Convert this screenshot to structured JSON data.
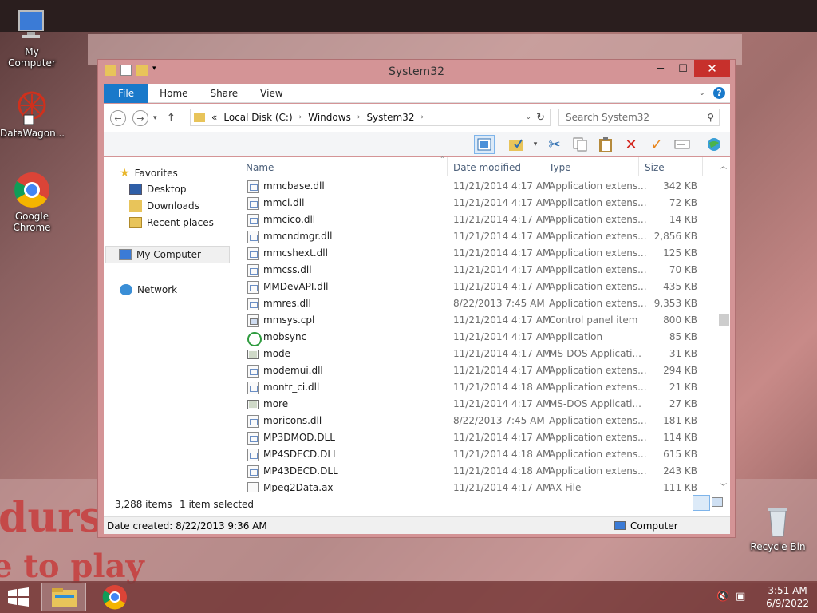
{
  "desktop": {
    "icons": [
      {
        "label": "My Computer"
      },
      {
        "label": "DataWagon..."
      },
      {
        "label": "Google Chrome"
      },
      {
        "label": "Recycle Bin"
      }
    ],
    "wallpaper_text": [
      "durst",
      "e to play"
    ]
  },
  "window": {
    "title": "System32",
    "buttons": {
      "minimize": "─",
      "maximize": "☐",
      "close": "✕"
    },
    "ribbon_tabs": [
      "File",
      "Home",
      "Share",
      "View"
    ],
    "address": {
      "prefix": "«",
      "crumbs": [
        "Local Disk (C:)",
        "Windows",
        "System32"
      ]
    },
    "search_placeholder": "Search System32",
    "accent": "#1979ca"
  },
  "navpane": {
    "items": [
      {
        "label": "Favorites"
      },
      {
        "label": "Desktop"
      },
      {
        "label": "Downloads"
      },
      {
        "label": "Recent places"
      },
      {
        "label": "My Computer"
      },
      {
        "label": "Network"
      }
    ]
  },
  "columns": [
    "Name",
    "Date modified",
    "Type",
    "Size"
  ],
  "files": [
    {
      "name": "mmcbase.dll",
      "date": "11/21/2014 4:17 AM",
      "type": "Application extens...",
      "size": "342 KB",
      "icon": "dll"
    },
    {
      "name": "mmci.dll",
      "date": "11/21/2014 4:17 AM",
      "type": "Application extens...",
      "size": "72 KB",
      "icon": "dll"
    },
    {
      "name": "mmcico.dll",
      "date": "11/21/2014 4:17 AM",
      "type": "Application extens...",
      "size": "14 KB",
      "icon": "dll"
    },
    {
      "name": "mmcndmgr.dll",
      "date": "11/21/2014 4:17 AM",
      "type": "Application extens...",
      "size": "2,856 KB",
      "icon": "dll"
    },
    {
      "name": "mmcshext.dll",
      "date": "11/21/2014 4:17 AM",
      "type": "Application extens...",
      "size": "125 KB",
      "icon": "dll"
    },
    {
      "name": "mmcss.dll",
      "date": "11/21/2014 4:17 AM",
      "type": "Application extens...",
      "size": "70 KB",
      "icon": "dll"
    },
    {
      "name": "MMDevAPI.dll",
      "date": "11/21/2014 4:17 AM",
      "type": "Application extens...",
      "size": "435 KB",
      "icon": "dll"
    },
    {
      "name": "mmres.dll",
      "date": "8/22/2013 7:45 AM",
      "type": "Application extens...",
      "size": "9,353 KB",
      "icon": "dll"
    },
    {
      "name": "mmsys.cpl",
      "date": "11/21/2014 4:17 AM",
      "type": "Control panel item",
      "size": "800 KB",
      "icon": "cpl"
    },
    {
      "name": "mobsync",
      "date": "11/21/2014 4:17 AM",
      "type": "Application",
      "size": "85 KB",
      "icon": "app"
    },
    {
      "name": "mode",
      "date": "11/21/2014 4:17 AM",
      "type": "MS-DOS Applicati...",
      "size": "31 KB",
      "icon": "msdos"
    },
    {
      "name": "modemui.dll",
      "date": "11/21/2014 4:17 AM",
      "type": "Application extens...",
      "size": "294 KB",
      "icon": "dll"
    },
    {
      "name": "montr_ci.dll",
      "date": "11/21/2014 4:18 AM",
      "type": "Application extens...",
      "size": "21 KB",
      "icon": "dll"
    },
    {
      "name": "more",
      "date": "11/21/2014 4:17 AM",
      "type": "MS-DOS Applicati...",
      "size": "27 KB",
      "icon": "msdos"
    },
    {
      "name": "moricons.dll",
      "date": "8/22/2013 7:45 AM",
      "type": "Application extens...",
      "size": "181 KB",
      "icon": "dll"
    },
    {
      "name": "MP3DMOD.DLL",
      "date": "11/21/2014 4:17 AM",
      "type": "Application extens...",
      "size": "114 KB",
      "icon": "dll"
    },
    {
      "name": "MP4SDECD.DLL",
      "date": "11/21/2014 4:18 AM",
      "type": "Application extens...",
      "size": "615 KB",
      "icon": "dll"
    },
    {
      "name": "MP43DECD.DLL",
      "date": "11/21/2014 4:18 AM",
      "type": "Application extens...",
      "size": "243 KB",
      "icon": "dll"
    },
    {
      "name": "Mpeg2Data.ax",
      "date": "11/21/2014 4:17 AM",
      "type": "AX File",
      "size": "111 KB",
      "icon": "ax"
    }
  ],
  "status": {
    "item_count": "3,288 items",
    "selection": "1 item selected",
    "details": "Date created: 8/22/2013 9:36 AM",
    "location": "Computer"
  },
  "taskbar": {
    "time": "3:51 AM",
    "date": "6/9/2022"
  }
}
